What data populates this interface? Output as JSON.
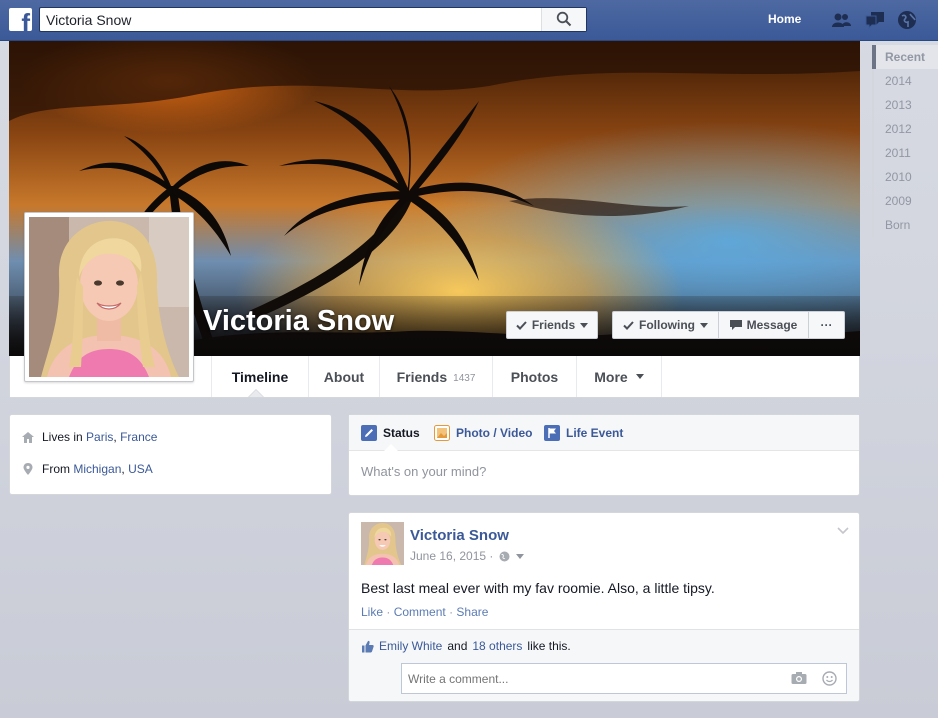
{
  "topbar": {
    "search_value": "Victoria Snow",
    "home_label": "Home"
  },
  "profile": {
    "name": "Victoria Snow",
    "buttons": {
      "friends": "Friends",
      "following": "Following",
      "message": "Message",
      "more": "···"
    }
  },
  "nav": {
    "tabs": [
      {
        "label": "Timeline"
      },
      {
        "label": "About"
      },
      {
        "label": "Friends",
        "count": "1437"
      },
      {
        "label": "Photos"
      },
      {
        "label": "More"
      }
    ]
  },
  "years": [
    "Recent",
    "2014",
    "2013",
    "2012",
    "2011",
    "2010",
    "2009",
    "Born"
  ],
  "info": {
    "lives_prefix": "Lives in",
    "lives_city": "Paris",
    "lives_sep": ",",
    "lives_country": "France",
    "from_prefix": "From",
    "from_region": "Michigan",
    "from_sep": ",",
    "from_country": "USA"
  },
  "composer": {
    "status_label": "Status",
    "photo_label": "Photo / Video",
    "life_event_label": "Life Event",
    "placeholder": "What's on your mind?"
  },
  "post": {
    "author": "Victoria Snow",
    "date": "June 16, 2015 ·",
    "text": "Best last meal ever with my fav roomie. Also, a little tipsy.",
    "action_like": "Like",
    "action_comment": "Comment",
    "action_share": "Share",
    "sep": "·",
    "likes_user": "Emily White",
    "likes_and": "and",
    "likes_others": "18 others",
    "likes_suffix": "like this.",
    "comment_placeholder": "Write a comment..."
  },
  "colors": {
    "brand": "#3b5998",
    "link": "#3b5998",
    "muted": "#90949c"
  },
  "icons": {
    "search": "search-icon",
    "friends": "friend-requests-icon",
    "messages": "messages-icon",
    "notifications": "globe-notifications-icon"
  }
}
